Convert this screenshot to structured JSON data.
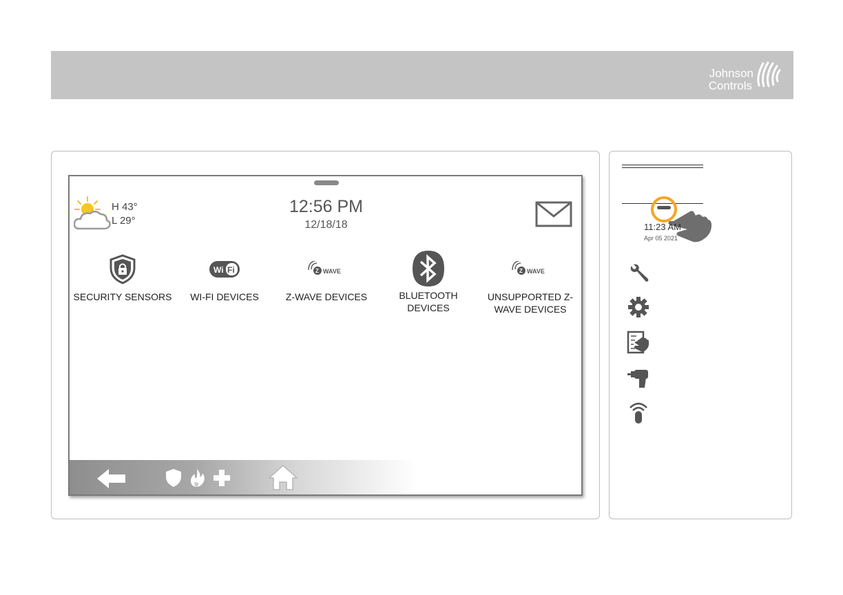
{
  "header": {
    "logo_line1": "Johnson",
    "logo_line2": "Controls"
  },
  "screen": {
    "weather": {
      "high": "H 43°",
      "low": "L 29°",
      "icon": "partly-cloudy-icon"
    },
    "time": "12:56 PM",
    "date": "12/18/18",
    "tiles": [
      {
        "label": "SECURITY SENSORS",
        "icon": "shield-lock-icon"
      },
      {
        "label": "WI-FI DEVICES",
        "icon": "wifi-logo-icon"
      },
      {
        "label": "Z-WAVE DEVICES",
        "icon": "zwave-logo-icon"
      },
      {
        "label": "BLUETOOTH DEVICES",
        "icon": "bluetooth-icon"
      },
      {
        "label": "UNSUPPORTED Z-WAVE DEVICES",
        "icon": "zwave-logo-icon"
      }
    ]
  },
  "side": {
    "time": "11:23 AM",
    "date": "Apr 05 2021",
    "menu_icons": [
      "wrench-icon",
      "gear-icon",
      "touch-panel-icon",
      "drill-icon",
      "wireless-remote-icon"
    ]
  },
  "colors": {
    "banner": "#c4c4c4",
    "accent_ring": "#f5a623"
  }
}
